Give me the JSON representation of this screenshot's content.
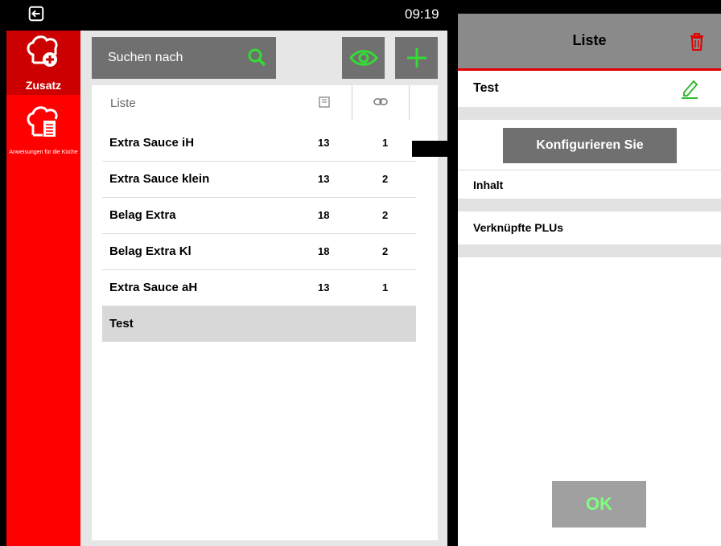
{
  "status": {
    "time": "09:19"
  },
  "sidebar": {
    "items": [
      {
        "label": "Zusatz",
        "icon": "chef-hat-plus-icon"
      },
      {
        "label": "Anweisungen für die Küche",
        "icon": "chef-hat-document-icon"
      }
    ]
  },
  "search": {
    "label": "Suchen nach"
  },
  "list": {
    "header": {
      "name": "Liste",
      "col1_icon": "pos-terminal-icon",
      "col2_icon": "link-icon"
    },
    "rows": [
      {
        "name": "Extra Sauce iH",
        "c1": "13",
        "c2": "1"
      },
      {
        "name": "Extra Sauce klein",
        "c1": "13",
        "c2": "2"
      },
      {
        "name": "Belag Extra",
        "c1": "18",
        "c2": "2"
      },
      {
        "name": "Belag Extra Kl",
        "c1": "18",
        "c2": "2"
      },
      {
        "name": "Extra Sauce aH",
        "c1": "13",
        "c2": "1"
      },
      {
        "name": "Test",
        "c1": "",
        "c2": ""
      }
    ]
  },
  "panel": {
    "title": "Liste",
    "item_name": "Test",
    "configure_label": "Konfigurieren Sie",
    "sections": [
      "Inhalt",
      "Verknüpfte PLUs"
    ],
    "ok_label": "OK"
  },
  "colors": {
    "accent": "#ff0000",
    "green": "#33dd33",
    "gray_button": "#707070"
  }
}
